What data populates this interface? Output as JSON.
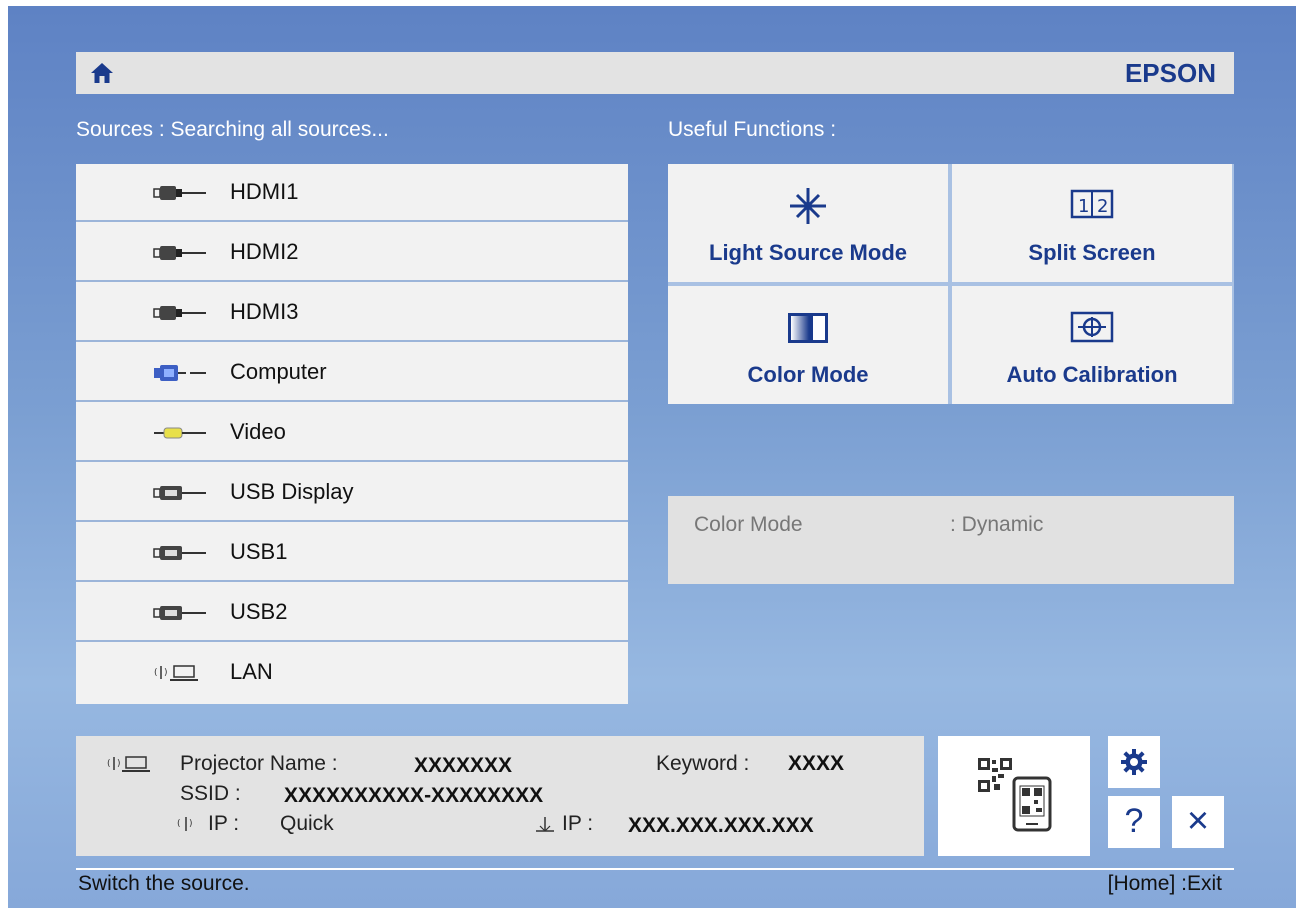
{
  "header": {
    "brand": "EPSON",
    "home_icon": "home-icon"
  },
  "sources": {
    "title": "Sources : Searching all sources...",
    "items": [
      {
        "label": "HDMI1",
        "icon": "hdmi-icon"
      },
      {
        "label": "HDMI2",
        "icon": "hdmi-icon"
      },
      {
        "label": "HDMI3",
        "icon": "hdmi-icon"
      },
      {
        "label": "Computer",
        "icon": "vga-icon"
      },
      {
        "label": "Video",
        "icon": "video-icon"
      },
      {
        "label": "USB Display",
        "icon": "usb-display-icon"
      },
      {
        "label": "USB1",
        "icon": "usb-icon"
      },
      {
        "label": "USB2",
        "icon": "usb-icon"
      },
      {
        "label": "LAN",
        "icon": "lan-icon"
      }
    ]
  },
  "functions": {
    "title": "Useful Functions :",
    "items": [
      {
        "label": "Light Source Mode",
        "icon": "light-source-icon"
      },
      {
        "label": "Split Screen",
        "icon": "split-screen-icon"
      },
      {
        "label": "Color Mode",
        "icon": "color-mode-icon"
      },
      {
        "label": "Auto Calibration",
        "icon": "auto-calibration-icon"
      }
    ]
  },
  "info": {
    "key": "Color Mode",
    "value": ": Dynamic"
  },
  "network": {
    "projector_name_label": "Projector Name :",
    "projector_name_value": "XXXXXXX",
    "keyword_label": "Keyword :",
    "keyword_value": "XXXX",
    "ssid_label": "SSID :",
    "ssid_value": "XXXXXXXXXX-XXXXXXXX",
    "ip_quick_label": "IP :",
    "ip_quick_value": "Quick",
    "ip_wired_label": "IP :",
    "ip_wired_value": "XXX.XXX.XXX.XXX"
  },
  "buttons": {
    "help": "?",
    "close": "×"
  },
  "status": {
    "message": "Switch the source.",
    "hint": "[Home] :Exit"
  },
  "colors": {
    "brand": "#1a3a8c",
    "panel": "#f2f2f2",
    "background": "#7b9fd2"
  }
}
